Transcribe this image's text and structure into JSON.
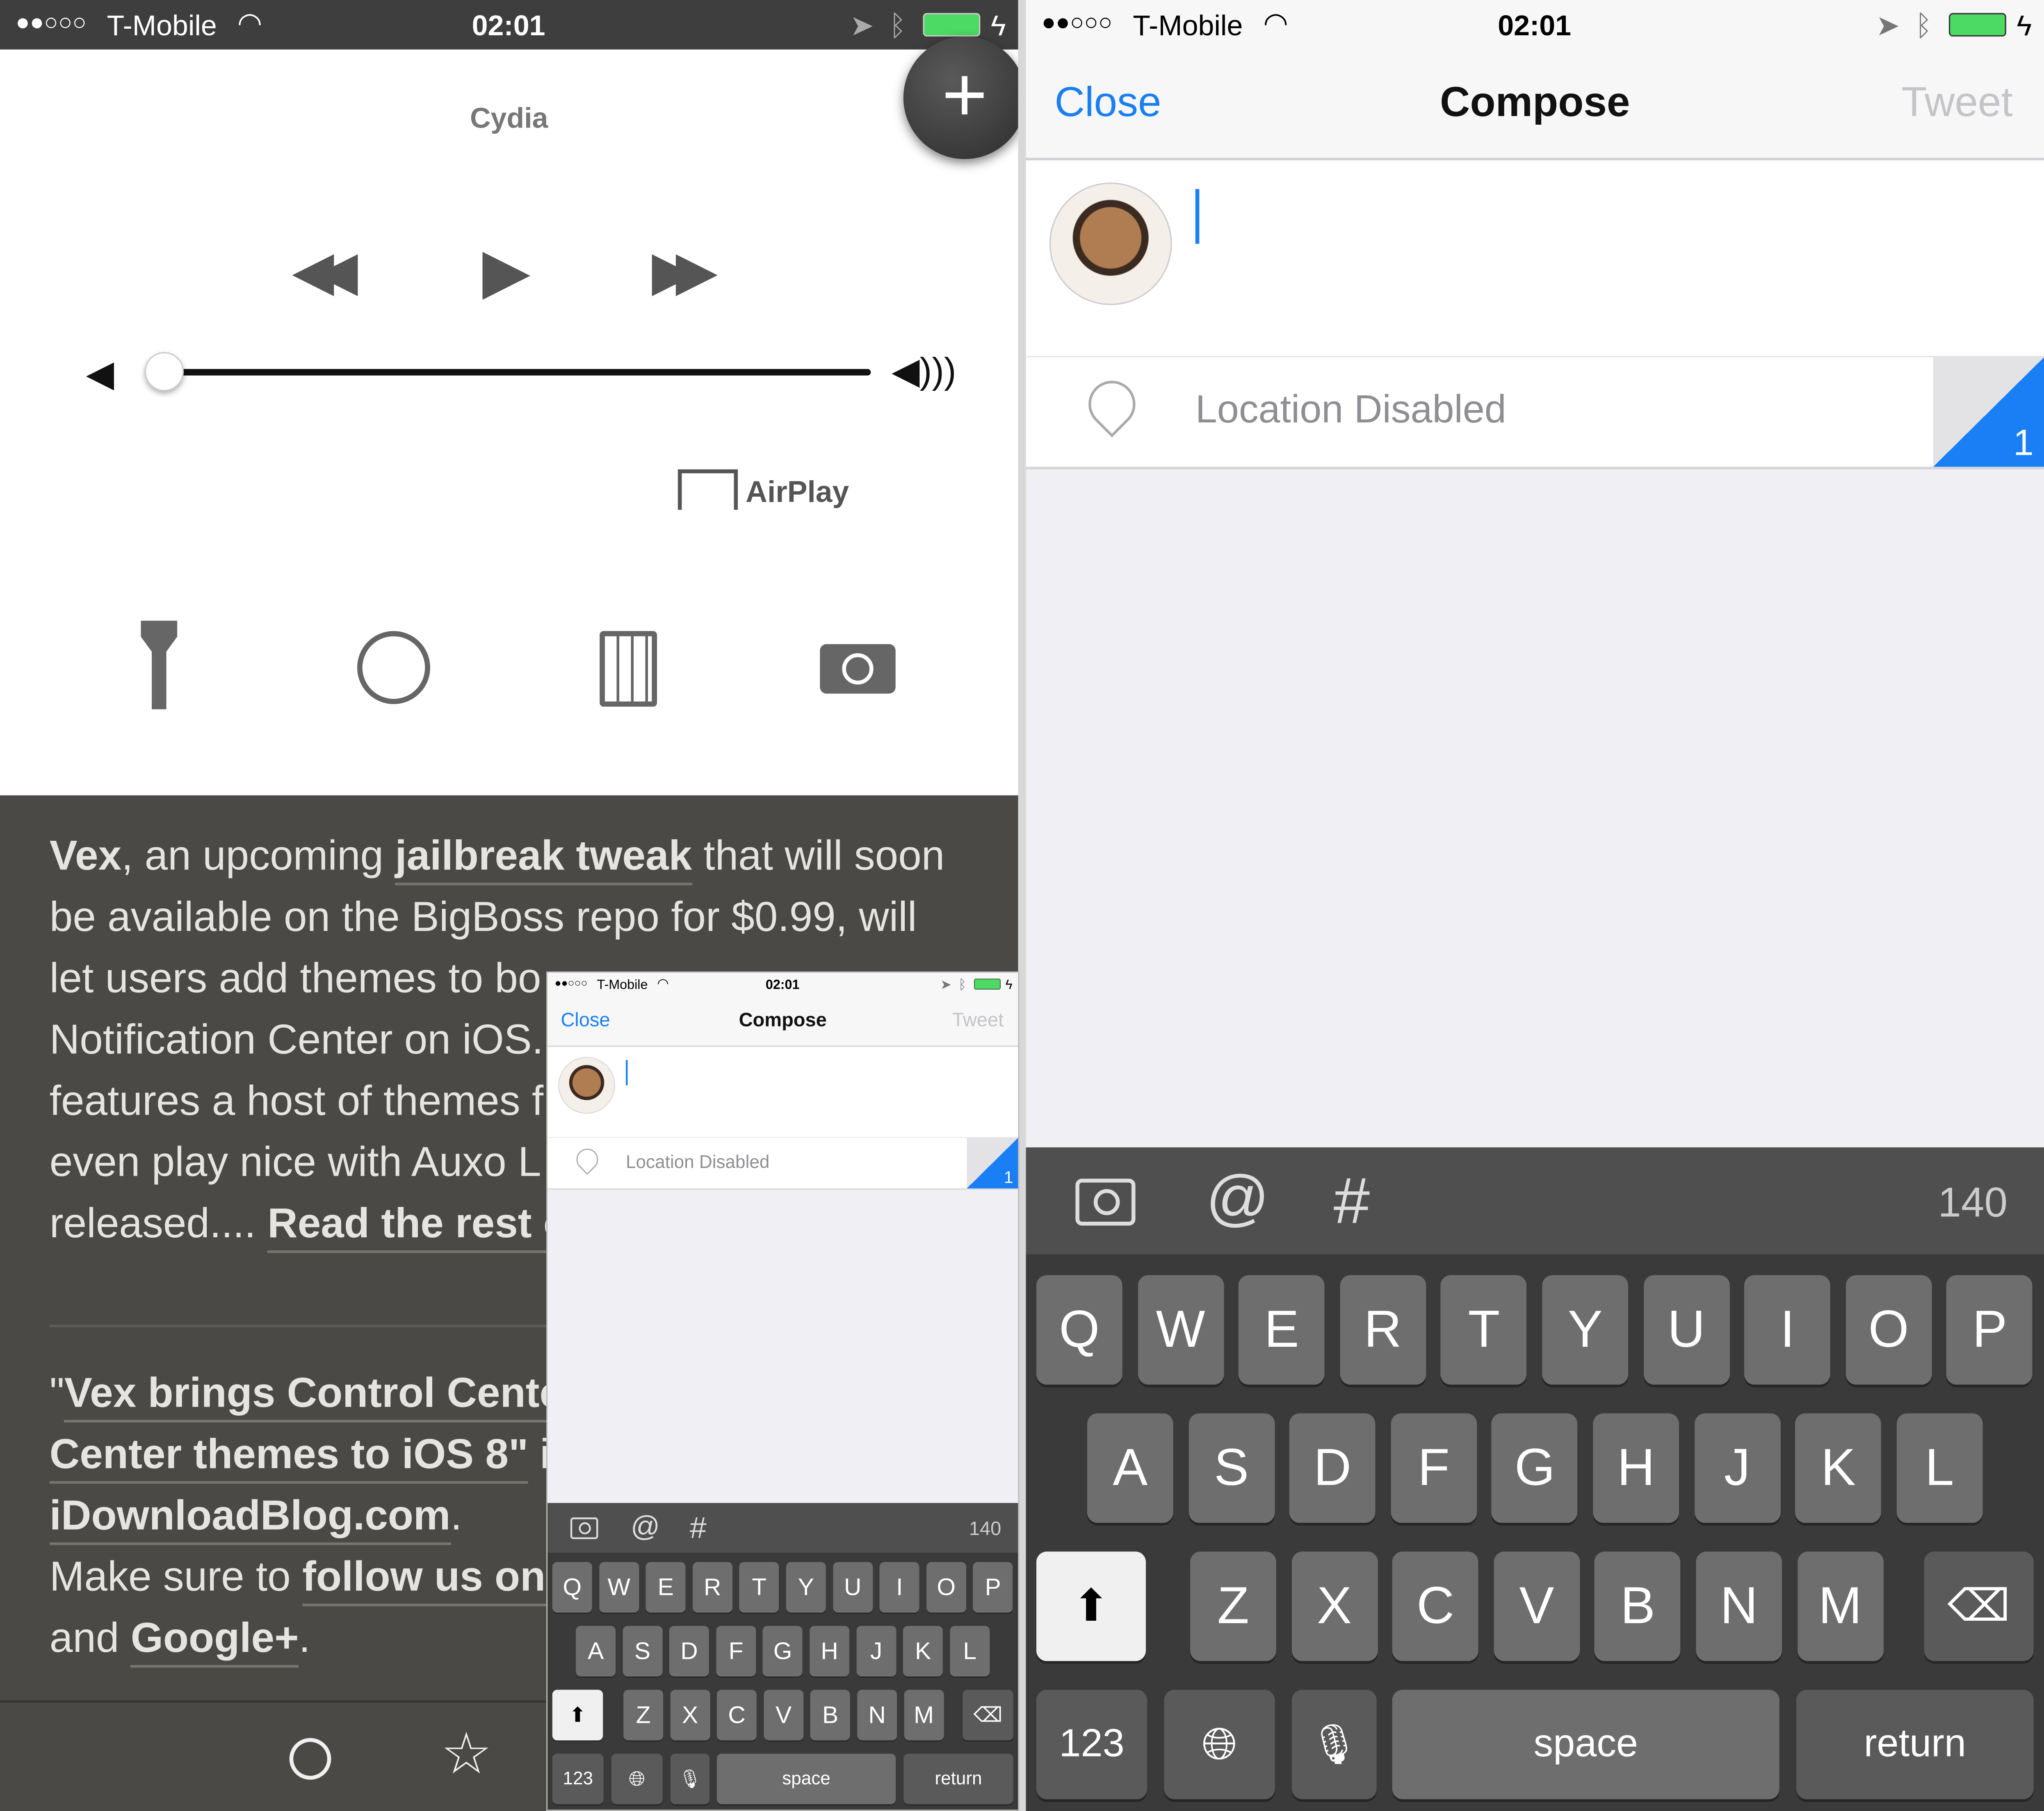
{
  "status": {
    "signal": "●●○○○",
    "carrier": "T-Mobile",
    "time": "02:01"
  },
  "control_center": {
    "now_playing": "Cydia",
    "airplay_label": "AirPlay",
    "volume_level": 0.0,
    "add_button_icon": "plus-icon",
    "shortcuts": [
      "flashlight-icon",
      "timer-icon",
      "calculator-icon",
      "camera-icon"
    ]
  },
  "article": {
    "lines": [
      [
        {
          "t": "Vex",
          "s": "b"
        },
        {
          "t": ", an upcoming "
        },
        {
          "t": "jailbreak tweak",
          "s": "u"
        },
        {
          "t": " that will soon"
        }
      ],
      [
        {
          "t": "be available on the BigBoss repo for $0.99, will"
        }
      ],
      [
        {
          "t": "let users add themes to bo"
        }
      ],
      [
        {
          "t": "Notification Center on iOS."
        }
      ],
      [
        {
          "t": "features a host of themes f"
        }
      ],
      [
        {
          "t": "even play nice with Auxo L"
        }
      ],
      [
        {
          "t": "released.... "
        },
        {
          "t": "Read the rest o",
          "s": "u"
        }
      ],
      [
        {
          "t": "\""
        },
        {
          "t": "Vex brings Control Cente",
          "s": "u"
        }
      ],
      [
        {
          "t": "Center themes to iOS 8\"",
          "s": "u"
        },
        {
          "t": " is"
        }
      ],
      [
        {
          "t": "iDownloadBlog.com",
          "s": "u"
        },
        {
          "t": "."
        }
      ],
      [
        {
          "t": "Make sure to "
        },
        {
          "t": "follow us on",
          "s": "u"
        }
      ],
      [
        {
          "t": "and "
        },
        {
          "t": "Google+",
          "s": "u"
        },
        {
          "t": "."
        }
      ]
    ],
    "toolbar_icons": [
      "circle-icon",
      "star-icon"
    ]
  },
  "compose": {
    "close": "Close",
    "title": "Compose",
    "tweet": "Tweet",
    "location": "Location Disabled",
    "corner_count": "1",
    "char_count": "140",
    "toolbar_hash": "#",
    "toolbar_at": "@",
    "accent": "#1a7ff5"
  },
  "keyboard": {
    "row1": [
      "Q",
      "W",
      "E",
      "R",
      "T",
      "Y",
      "U",
      "I",
      "O",
      "P"
    ],
    "row2": [
      "A",
      "S",
      "D",
      "F",
      "G",
      "H",
      "J",
      "K",
      "L"
    ],
    "row3": [
      "Z",
      "X",
      "C",
      "V",
      "B",
      "N",
      "M"
    ],
    "numbers": "123",
    "space": "space",
    "return": "return"
  }
}
